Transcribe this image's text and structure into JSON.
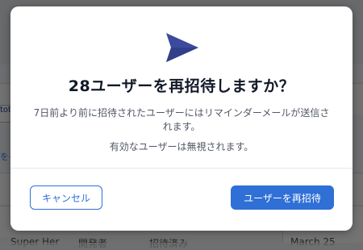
{
  "background": {
    "left_fragment": "tot",
    "left_link": "を→",
    "table_row": [
      "Super Her",
      "開発者",
      "招待済み",
      "March 25"
    ]
  },
  "modal": {
    "icon": "send-icon",
    "title": "28ユーザーを再招待しますか？",
    "description": "7日前より前に招待されたユーザーにはリマインダーメールが送信されます。",
    "note": "有効なユーザーは無視されます。",
    "cancel_label": "キャンセル",
    "confirm_label": "ユーザーを再招待"
  },
  "colors": {
    "accent": "#2f6fd6",
    "icon": "#3b4a9c",
    "overlay": "rgba(0,0,0,0.55)"
  }
}
